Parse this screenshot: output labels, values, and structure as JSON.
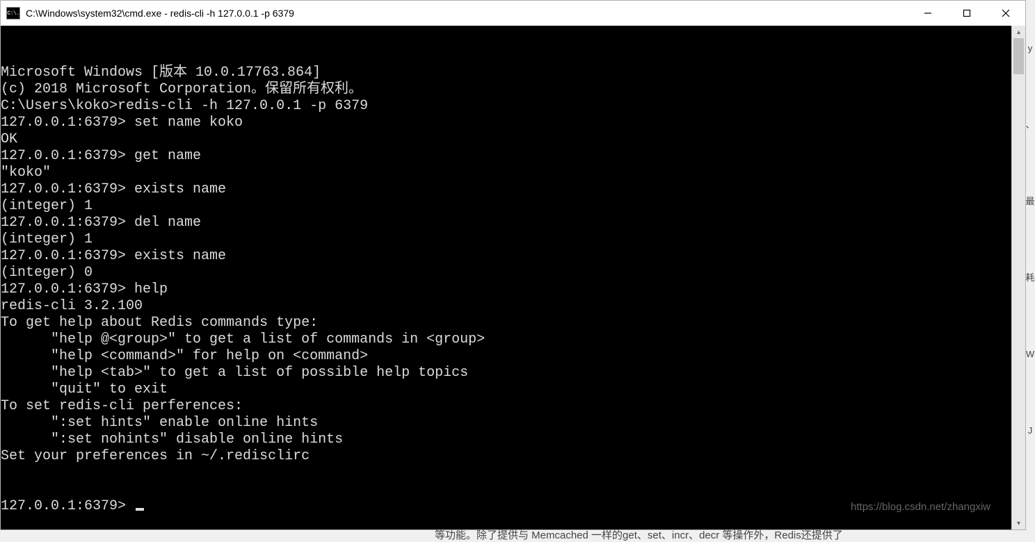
{
  "titlebar": {
    "icon_text": "C:\\.",
    "title": "C:\\Windows\\system32\\cmd.exe - redis-cli  -h 127.0.0.1 -p 6379"
  },
  "terminal": {
    "lines": [
      "Microsoft Windows [版本 10.0.17763.864]",
      "(c) 2018 Microsoft Corporation。保留所有权利。",
      "",
      "C:\\Users\\koko>redis-cli -h 127.0.0.1 -p 6379",
      "127.0.0.1:6379> set name koko",
      "OK",
      "127.0.0.1:6379> get name",
      "\"koko\"",
      "127.0.0.1:6379> exists name",
      "(integer) 1",
      "127.0.0.1:6379> del name",
      "(integer) 1",
      "127.0.0.1:6379> exists name",
      "(integer) 0",
      "127.0.0.1:6379> help",
      "redis-cli 3.2.100",
      "To get help about Redis commands type:",
      "      \"help @<group>\" to get a list of commands in <group>",
      "      \"help <command>\" for help on <command>",
      "      \"help <tab>\" to get a list of possible help topics",
      "      \"quit\" to exit",
      "",
      "To set redis-cli perferences:",
      "      \":set hints\" enable online hints",
      "      \":set nohints\" disable online hints",
      "Set your preferences in ~/.redisclirc"
    ],
    "prompt": "127.0.0.1:6379> "
  },
  "watermark": "https://blog.csdn.net/zhangxiw",
  "right_strip": [
    "y",
    "、",
    "最",
    "耗",
    "W",
    "J"
  ],
  "bottom_partial": "等功能。除了提供与 Memcached 一样的get、set、incr、decr 等操作外，Redis还提供了"
}
